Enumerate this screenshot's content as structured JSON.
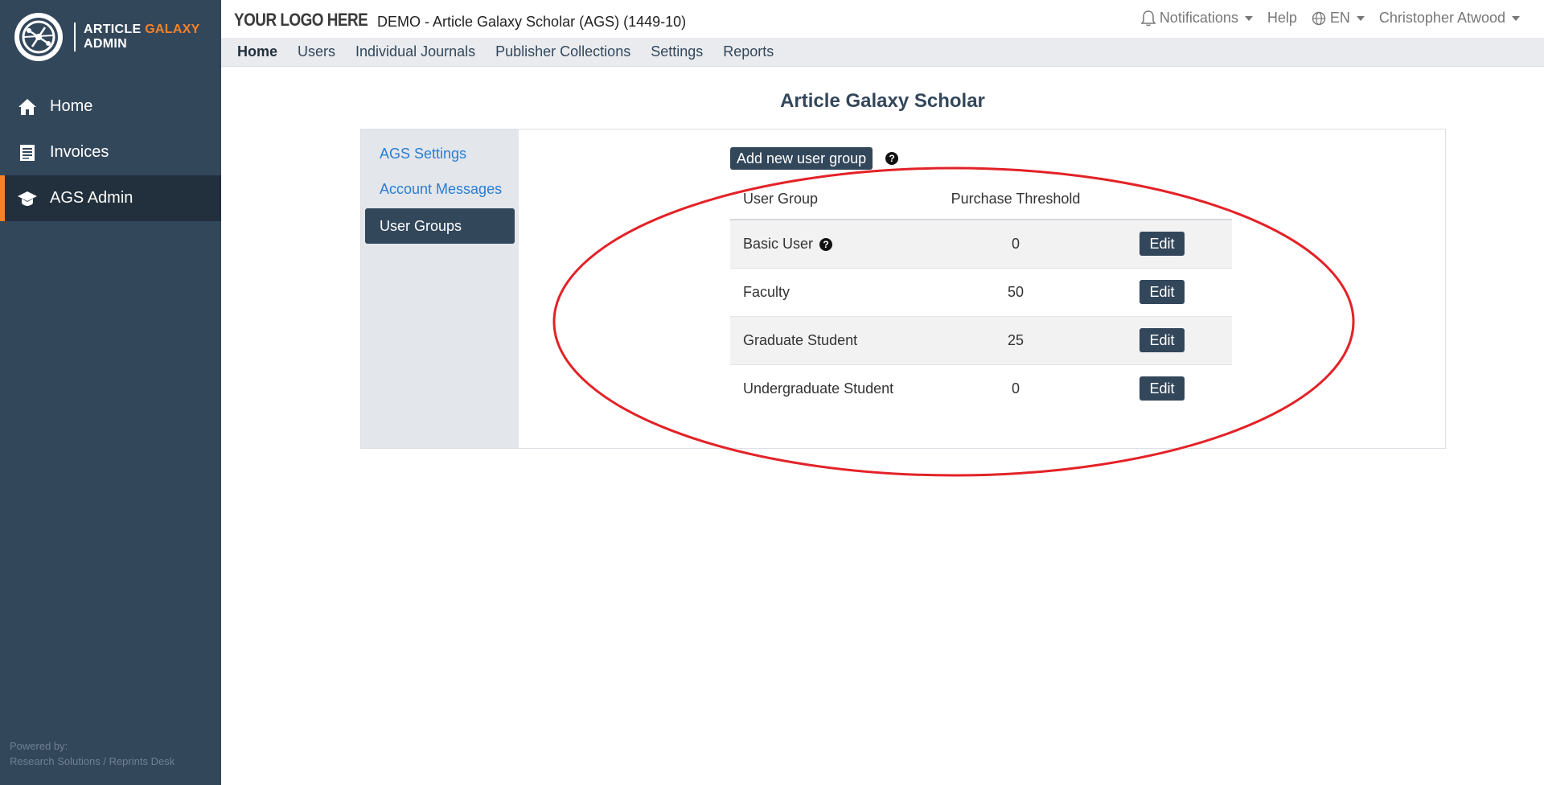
{
  "brand": {
    "line1": "ARTICLE",
    "line1_accent": "GALAXY",
    "line2": "ADMIN",
    "accent_color": "#f5822a"
  },
  "sidebar": {
    "items": [
      {
        "label": "Home",
        "icon": "home-icon",
        "active": false
      },
      {
        "label": "Invoices",
        "icon": "invoice-icon",
        "active": false
      },
      {
        "label": "AGS Admin",
        "icon": "graduation-cap-icon",
        "active": true
      }
    ],
    "powered_by": "Powered by:",
    "powered_by_company": "Research Solutions / Reprints Desk"
  },
  "topbar": {
    "logo_text": "YOUR LOGO HERE",
    "demo_title": "DEMO - Article Galaxy Scholar (AGS) (1449-10)",
    "notifications": "Notifications",
    "help": "Help",
    "language": "EN",
    "user": "Christopher Atwood"
  },
  "menubar": {
    "items": [
      {
        "label": "Home",
        "active": true
      },
      {
        "label": "Users"
      },
      {
        "label": "Individual Journals"
      },
      {
        "label": "Publisher Collections"
      },
      {
        "label": "Settings"
      },
      {
        "label": "Reports"
      }
    ]
  },
  "page": {
    "title": "Article Galaxy Scholar"
  },
  "panel_nav": {
    "items": [
      {
        "label": "AGS Settings"
      },
      {
        "label": "Account Messages"
      },
      {
        "label": "User Groups",
        "active": true
      }
    ]
  },
  "user_groups": {
    "add_button": "Add new user group",
    "help_glyph": "?",
    "columns": [
      "User Group",
      "Purchase Threshold"
    ],
    "edit_label": "Edit",
    "rows": [
      {
        "name": "Basic User",
        "threshold": "0",
        "has_help": true
      },
      {
        "name": "Faculty",
        "threshold": "50"
      },
      {
        "name": "Graduate Student",
        "threshold": "25"
      },
      {
        "name": "Undergraduate Student",
        "threshold": "0"
      }
    ]
  },
  "colors": {
    "sidebar_bg": "#33475b",
    "sidebar_active": "#22303d",
    "link_blue": "#2a7dd4",
    "annotation_red": "#e32227"
  }
}
